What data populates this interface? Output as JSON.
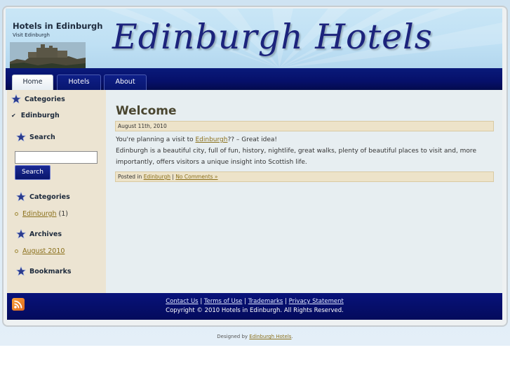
{
  "header": {
    "site_title": "Hotels in Edinburgh",
    "site_subtitle": "Visit Edinburgh",
    "banner_title": "Edinburgh Hotels"
  },
  "nav": {
    "tabs": [
      {
        "label": "Home",
        "active": true
      },
      {
        "label": "Hotels",
        "active": false
      },
      {
        "label": "About",
        "active": false
      }
    ]
  },
  "sidebar": {
    "categories_heading": "Categories",
    "active_category": "Edinburgh",
    "search_heading": "Search",
    "search_value": "",
    "search_button": "Search",
    "categories_heading_2": "Categories",
    "category_item": {
      "label": "Edinburgh",
      "count": "(1)"
    },
    "archives_heading": "Archives",
    "archive_item": "August 2010",
    "bookmarks_heading": "Bookmarks"
  },
  "post": {
    "title": "Welcome",
    "date": "August 11th, 2010",
    "p1_before": "You're planning a visit to ",
    "p1_link": "Edinburgh",
    "p1_after": "?? – Great idea!",
    "p2": "Edinburgh is a beautiful city, full of fun, history, nightlife, great walks, plenty of beautiful places to visit and, more importantly, offers visitors a unique insight into Scottish life.",
    "posted_in_prefix": "Posted in ",
    "posted_in_link": "Edinburgh",
    "separator": " | ",
    "comments_link": "No Comments »"
  },
  "footer": {
    "links": [
      "Contact Us",
      "Terms of Use",
      "Trademarks",
      "Privacy Statement"
    ],
    "link_separator": " | ",
    "copyright": "Copyright © 2010 Hotels in Edinburgh. All Rights Reserved.",
    "designed_prefix": "Designed by ",
    "designed_link": "Edinburgh Hotels",
    "designed_suffix": "."
  },
  "colors": {
    "nav_bg": "#06106a",
    "sidebar_bg": "#ece4d2",
    "main_bg": "#e7eef1",
    "link": "#8a6f1a",
    "title": "#1c237c"
  }
}
